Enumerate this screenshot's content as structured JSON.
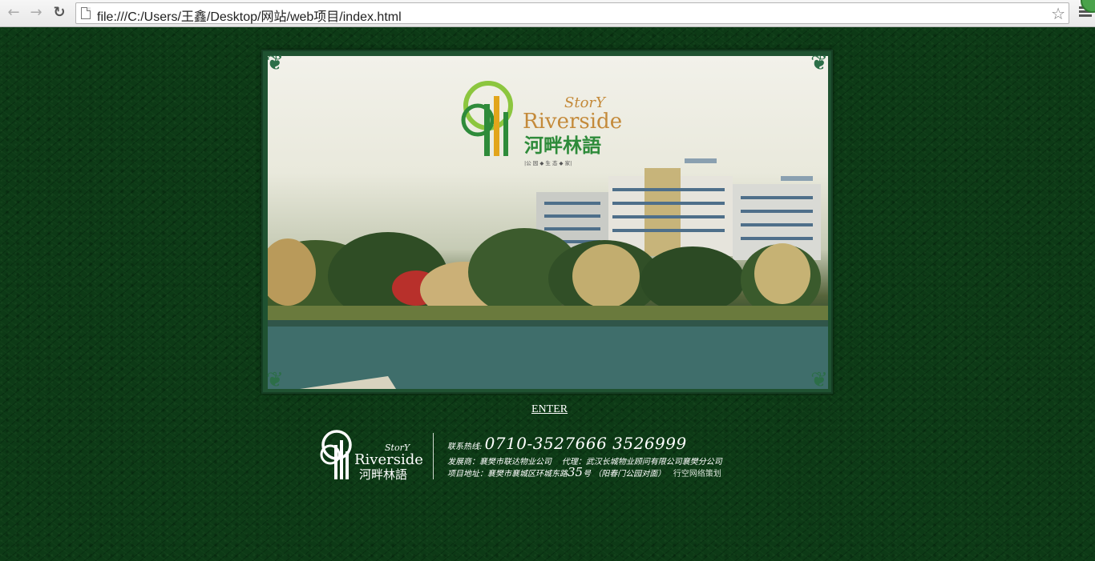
{
  "browser": {
    "url": "file:///C:/Users/王鑫/Desktop/网站/web项目/index.html",
    "back_icon": "back-arrow-icon",
    "forward_icon": "forward-arrow-icon",
    "reload_icon": "reload-icon",
    "bookmark_icon": "star-icon",
    "menu_icon": "hamburger-menu-icon"
  },
  "hero": {
    "logo_top": "StorY",
    "logo_brand": "Riverside",
    "logo_cn": "河畔林語",
    "logo_tagline": "|公 园 ◆ 生 态 ◆ 家|"
  },
  "enter_label": "ENTER",
  "footer": {
    "logo_top": "StorY",
    "logo_brand": "Riverside",
    "logo_cn": "河畔林語",
    "hotline_label": "联系热线:",
    "hotline_number": "0710-3527666 3526999",
    "developer": "发展商：襄樊市联达物业公司",
    "agent": "代理：武汉长城物业顾问有限公司襄樊分公司",
    "address_label": "项目地址：襄樊市襄城区环城东路",
    "address_num": "35",
    "address_suffix": "号  （阳春门公园对面）",
    "credit": "行空网络策划"
  },
  "colors": {
    "page_bg": "#0d3a16",
    "frame": "#1f5231",
    "logo_green": "#2e8b3a",
    "logo_brown": "#c48a3a"
  }
}
